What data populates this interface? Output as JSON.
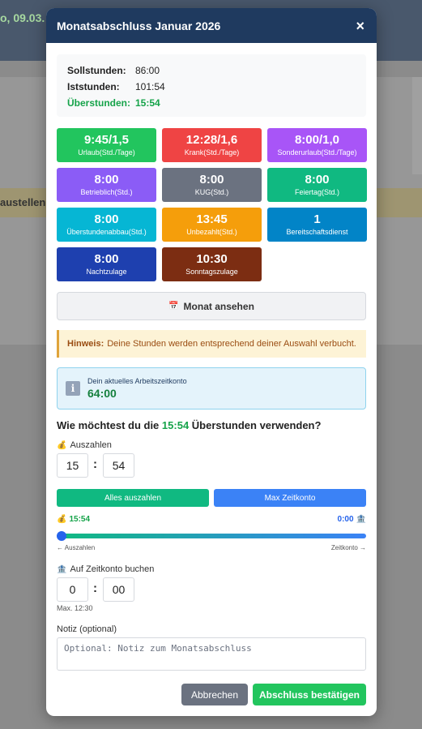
{
  "background": {
    "header_text": "o, 09.03.",
    "banner_text": "austellen"
  },
  "modal": {
    "title": "Monatsabschluss Januar 2026",
    "close_glyph": "×"
  },
  "summary": {
    "soll_label": "Sollstunden:",
    "soll_value": "86:00",
    "ist_label": "Iststunden:",
    "ist_value": "101:54",
    "over_label": "Überstunden:",
    "over_value": "15:54"
  },
  "tiles": [
    {
      "value": "9:45/1,5",
      "label": "Urlaub(Std./Tage)",
      "color": "#22c55e"
    },
    {
      "value": "12:28/1,6",
      "label": "Krank(Std./Tage)",
      "color": "#ef4444"
    },
    {
      "value": "8:00/1,0",
      "label": "Sonderurlaub(Std./Tage)",
      "color": "#a855f7"
    },
    {
      "value": "8:00",
      "label": "Betrieblich(Std.)",
      "color": "#8b5cf6"
    },
    {
      "value": "8:00",
      "label": "KUG(Std.)",
      "color": "#6b7280"
    },
    {
      "value": "8:00",
      "label": "Feiertag(Std.)",
      "color": "#10b981"
    },
    {
      "value": "8:00",
      "label": "Überstundenabbau(Std.)",
      "color": "#06b6d4"
    },
    {
      "value": "13:45",
      "label": "Unbezahlt(Std.)",
      "color": "#f59e0b"
    },
    {
      "value": "1",
      "label": "Bereitschaftsdienst",
      "color": "#0284c7"
    },
    {
      "value": "8:00",
      "label": "Nachtzulage",
      "color": "#1e40af"
    },
    {
      "value": "10:30",
      "label": "Sonntagszulage",
      "color": "#7c2d12"
    }
  ],
  "month_button": {
    "icon": "📅",
    "label": "Monat ansehen"
  },
  "hint": {
    "bold": "Hinweis:",
    "text": "Deine Stunden werden entsprechend deiner Auswahl verbucht."
  },
  "account": {
    "icon": "i",
    "label": "Dein aktuelles Arbeitszeitkonto",
    "value": "64:00"
  },
  "question": {
    "prefix": "Wie möchtest du die",
    "highlight": "15:54",
    "suffix": "Überstunden verwenden?"
  },
  "payout": {
    "icon": "💰",
    "label": "Auszahlen",
    "hours": "15",
    "minutes": "54",
    "separator": ":"
  },
  "buttons": {
    "all_payout": "Alles auszahlen",
    "max_account": "Max Zeitkonto",
    "cancel": "Abbrechen",
    "confirm": "Abschluss bestätigen"
  },
  "slider": {
    "left_icon": "💰",
    "left_value": "15:54",
    "right_value": "0:00",
    "right_icon": "🏦",
    "left_caption": "← Auszahlen",
    "right_caption": "Zeitkonto →",
    "position": 0
  },
  "account_booking": {
    "icon": "🏦",
    "label": "Auf Zeitkonto buchen",
    "hours": "0",
    "minutes": "00",
    "separator": ":",
    "max_note": "Max. 12:30"
  },
  "note": {
    "label": "Notiz (optional)",
    "placeholder": "Optional: Notiz zum Monatsabschluss",
    "value": ""
  }
}
